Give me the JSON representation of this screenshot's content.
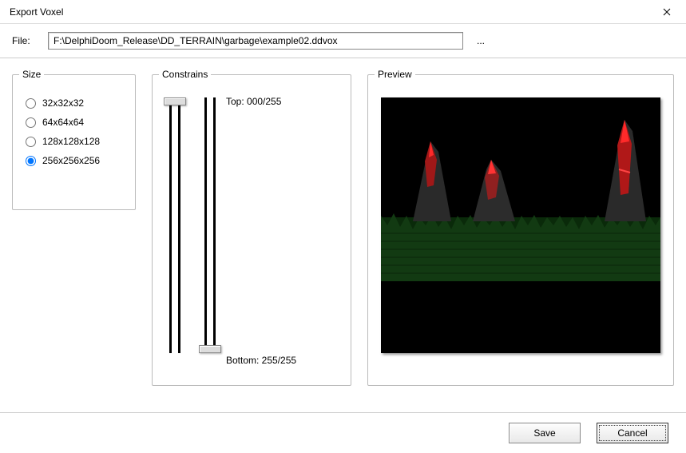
{
  "window": {
    "title": "Export Voxel"
  },
  "file": {
    "label": "File:",
    "path": "F:\\DelphiDoom_Release\\DD_TERRAIN\\garbage\\example02.ddvox",
    "browse": "..."
  },
  "size": {
    "legend": "Size",
    "options": [
      {
        "label": "32x32x32",
        "checked": false
      },
      {
        "label": "64x64x64",
        "checked": false
      },
      {
        "label": "128x128x128",
        "checked": false
      },
      {
        "label": "256x256x256",
        "checked": true
      }
    ]
  },
  "constrains": {
    "legend": "Constrains",
    "top_label": "Top: 000/255",
    "bottom_label": "Bottom: 255/255"
  },
  "preview": {
    "legend": "Preview"
  },
  "buttons": {
    "save": "Save",
    "cancel": "Cancel"
  }
}
